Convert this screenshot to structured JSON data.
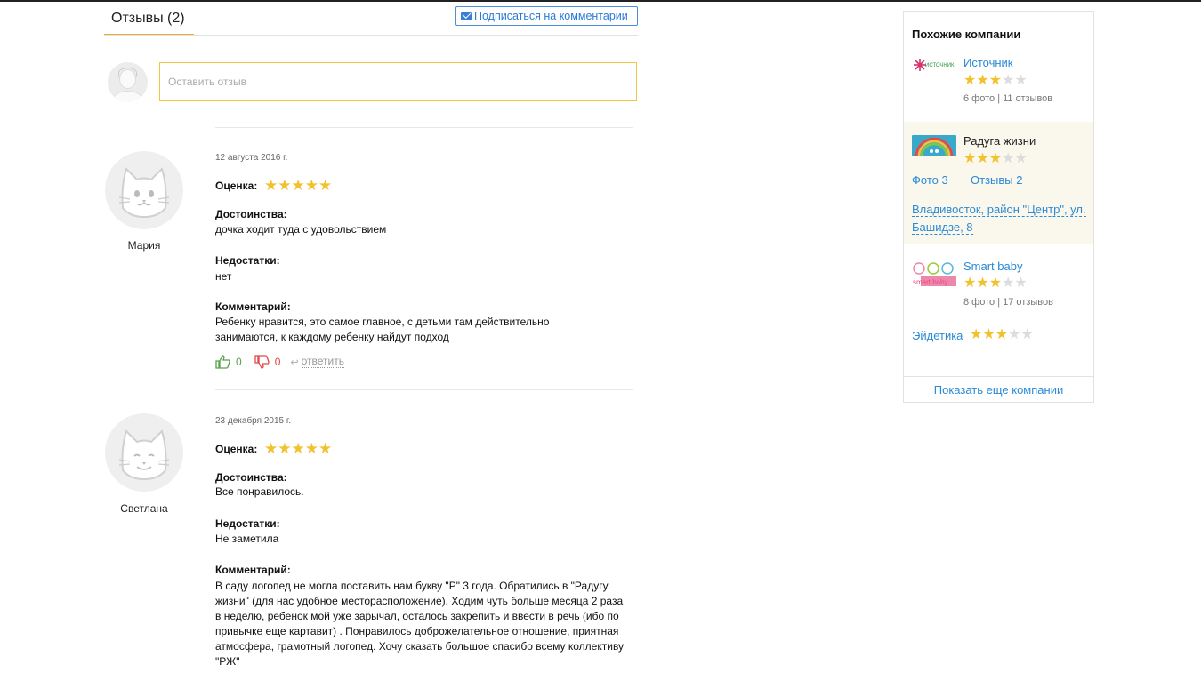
{
  "reviews": {
    "tab_label": "Отзывы (2)",
    "subscribe_label": "Подписаться на комментарии",
    "input_placeholder": "Оставить отзыв",
    "rating_label": "Оценка:",
    "pros_label": "Достоинства:",
    "cons_label": "Недостатки:",
    "comment_label": "Комментарий:",
    "items": [
      {
        "date": "12 августа 2016 г.",
        "author": "Мария",
        "rating": 5,
        "pros": "дочка ходит туда с удовольствием",
        "cons": "нет",
        "comment": "Ребенку нравится, это самое главное, с детьми там действительно занимаются, к каждому ребенку найдут подход",
        "likes": "0",
        "dislikes": "0",
        "reply_label": "ответить"
      },
      {
        "date": "23 декабря 2015 г.",
        "author": "Светлана",
        "rating": 5,
        "pros": "Все понравилось.",
        "cons": "Не заметила",
        "comment": "В саду логопед не могла поставить нам букву \"Р\" 3 года. Обратились в \"Радугу жизни\" (для нас удобное месторасположение). Ходим чуть больше месяца 2 раза в неделю, ребенок мой уже зарычал, осталось закрепить и ввести в речь (ибо по привычке еще картавит) . Понравилось доброжелательное отношение, приятная атмосфера, грамотный логопед. Хочу сказать большое спасибо всему коллективу \"РЖ\""
      }
    ]
  },
  "sidebar": {
    "title": "Похожие компании",
    "companies": [
      {
        "name": "Источник",
        "logo_text": "ИСТОЧНИК",
        "rating": 3,
        "meta": "6 фото | 11 отзывов"
      },
      {
        "name": "Радуга жизни",
        "rating": 3,
        "photos_label": "Фото 3",
        "reviews_label": "Отзывы 2",
        "address": "Владивосток, район \"Центр\", ул. Башидзе, 8"
      },
      {
        "name": "Smart baby",
        "logo_text": "smart baby",
        "rating": 3,
        "meta": "8 фото | 17 отзывов"
      },
      {
        "name": "Эйдетика",
        "rating": 3
      }
    ],
    "more_label": "Показать еще компании"
  },
  "colors": {
    "accent": "#f0a830",
    "link": "#2a8ad6",
    "star": "#f2c22e",
    "like": "#5aa04a",
    "dislike": "#e04848"
  }
}
